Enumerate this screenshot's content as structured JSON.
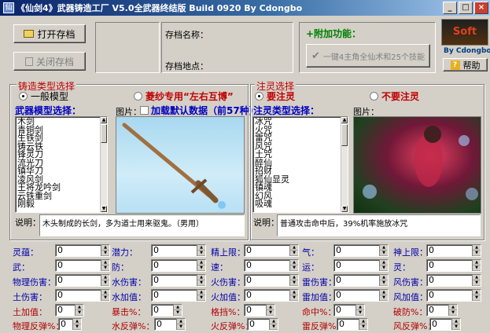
{
  "titlebar": {
    "icon": "仙",
    "text": "《仙剑4》武器铸造工厂 V5.0全武器终结版 Build 0920 By Cdongbo"
  },
  "top": {
    "open_btn": "打开存档",
    "close_btn": "关闭存档",
    "save_name_label": "存档名称：",
    "save_loc_label": "存档地点：",
    "extra_label": "+附加功能：",
    "extra_btn": "一键4主角全仙术和25个技能",
    "logo_text": "Soft",
    "by_label": "By Cdongbo",
    "help_btn": "帮助"
  },
  "forge": {
    "title": "铸造类型选择",
    "radio1": "一般模型",
    "radio2": "菱纱专用“左右互博”",
    "model_label": "武器模型选择：",
    "pic_label": "图片：",
    "load_default": "加载默认数据（前57种）",
    "items": [
      "木剑",
      "青铜剑",
      "生铁剑",
      "铸云铁",
      "锋灵刀",
      "流光刀",
      "镇华刀",
      "凌风剑",
      "王将龙吟剑",
      "云铁重剑",
      "刚毅"
    ],
    "desc_label": "说明：",
    "desc": "木头制成的长剑，多为道士用来驱鬼。（男用）"
  },
  "spirit": {
    "title": "注灵选择",
    "radio1": "要注灵",
    "radio2": "不要注灵",
    "type_label": "注灵类型选择：",
    "pic_label": "图片：",
    "items": [
      "冰咒",
      "火咒",
      "雷咒",
      "风咒",
      "土咒",
      "醉仙",
      "招财",
      "狐仙显灵",
      "镇魂",
      "幻风",
      "吸魂"
    ],
    "desc_label": "说明：",
    "desc": "普通攻击命中后，39%机率施放冰咒"
  },
  "stats": [
    [
      "灵蕴：",
      "0",
      "潜力：",
      "0",
      "精上限：",
      "0",
      "气：",
      "0",
      "神上限：",
      "0"
    ],
    [
      "武：",
      "0",
      "防：",
      "0",
      "速：",
      "0",
      "运：",
      "0",
      "灵：",
      "0"
    ],
    [
      "物理伤害：",
      "0",
      "水伤害：",
      "0",
      "火伤害：",
      "0",
      "雷伤害：",
      "0",
      "风伤害：",
      "0"
    ],
    [
      "土伤害：",
      "0",
      "水加值：",
      "0",
      "火加值：",
      "0",
      "雷加值：",
      "0",
      "风加值：",
      "0"
    ],
    [
      "土加值：",
      "0",
      "暴击%：",
      "0",
      "格挡%：",
      "0",
      "命中%：",
      "0",
      "破防%：",
      "0"
    ],
    [
      "物理反弹%：",
      "0",
      "水反弹%：",
      "0",
      "火反弹%：",
      "0",
      "雷反弹%：",
      "0",
      "风反弹%：",
      "0"
    ]
  ]
}
